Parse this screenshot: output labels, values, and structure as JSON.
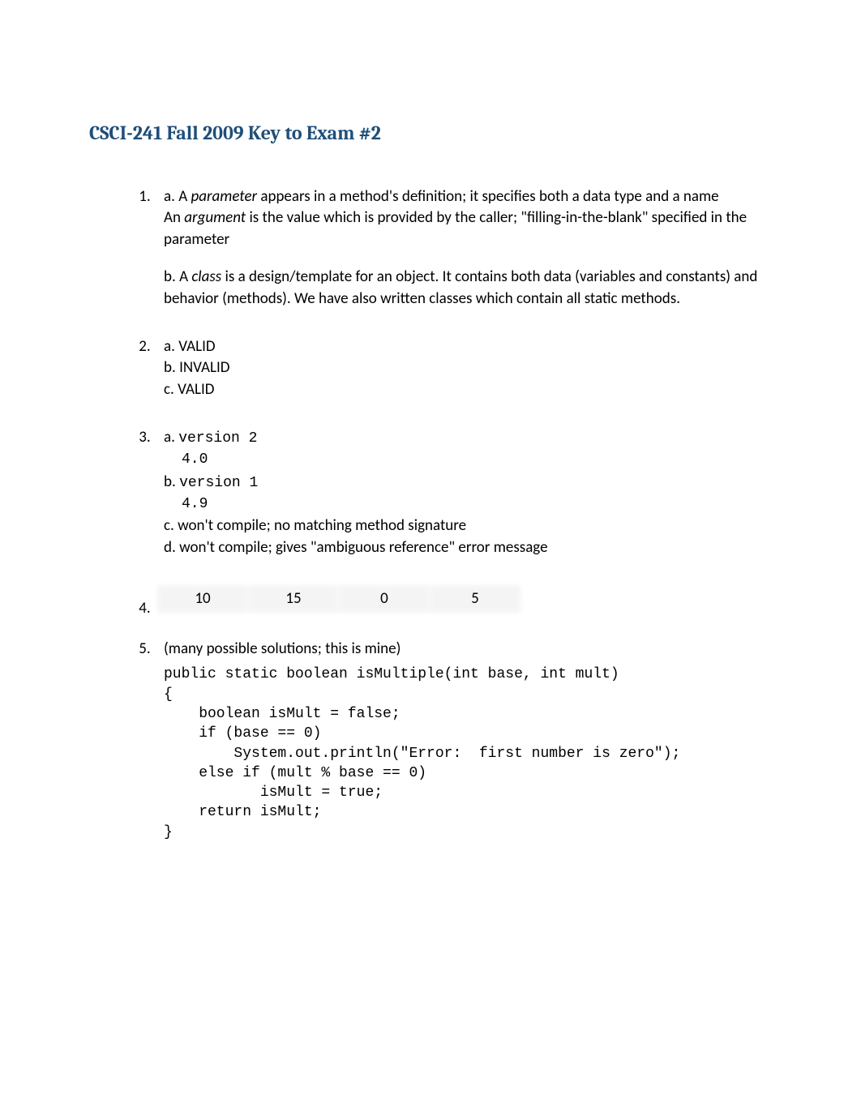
{
  "title": "CSCI-241    Fall 2009   Key to Exam #2",
  "q1": {
    "a_prefix": "a.  A ",
    "a_term": "parameter",
    "a_mid": " appears in a method's definition; it specifies both a data type and a name",
    "a_line2_prefix": "An ",
    "a_line2_term": "argument",
    "a_line2_rest": " is the value which is provided by the caller; \"filling-in-the-blank\" specified in the parameter",
    "b_prefix": "b. A ",
    "b_term": "class",
    "b_rest": " is a design/template for an object.  It contains both data (variables and constants) and behavior (methods).   We have also written classes which contain all static methods."
  },
  "q2": {
    "a": "a. VALID",
    "b": "b. INVALID",
    "c": "c. VALID"
  },
  "q3": {
    "a_label": "a.",
    "a_code1": "version 2",
    "a_code2": "4.0",
    "b_label": "b.",
    "b_code1": "version 1",
    "b_code2": "4.9",
    "c": "c. won't compile; no matching method signature",
    "d": "d. won't compile; gives \"ambiguous reference\" error message"
  },
  "q4": {
    "values": [
      "10",
      "15",
      "0",
      "5"
    ]
  },
  "q5": {
    "intro": "(many possible solutions; this is mine)",
    "code": "public static boolean isMultiple(int base, int mult)\n{\n    boolean isMult = false;\n    if (base == 0)\n        System.out.println(\"Error:  first number is zero\");\n    else if (mult % base == 0)\n           isMult = true;\n    return isMult;\n}"
  }
}
